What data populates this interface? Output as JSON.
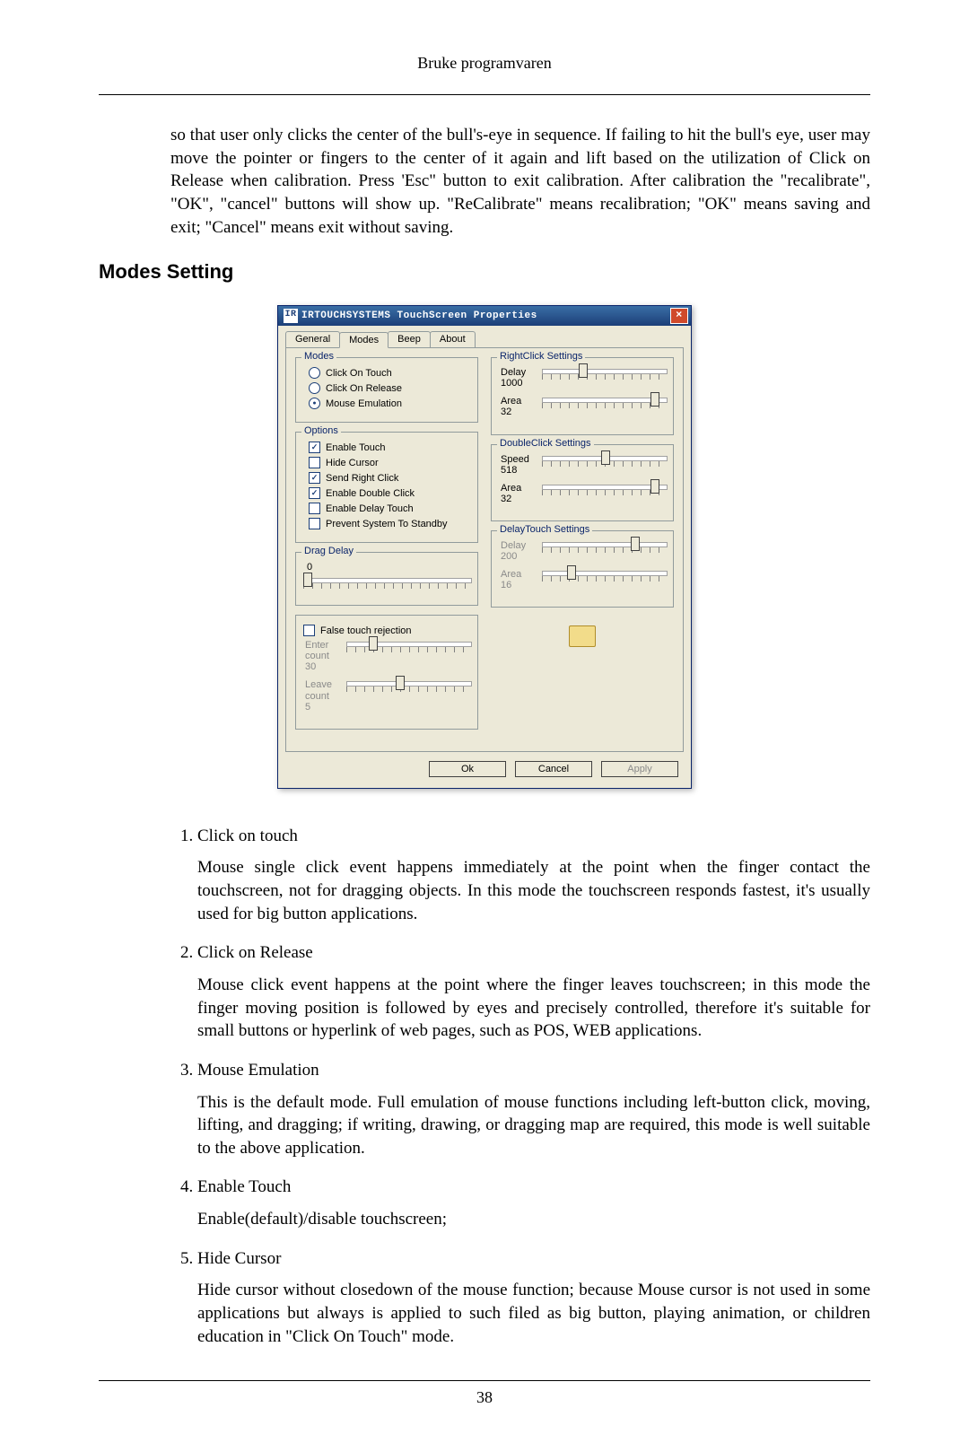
{
  "header": {
    "running_head": "Bruke programvaren"
  },
  "intro_paragraph": "so that user only clicks the center of the bull's-eye in sequence. If failing to hit the bull's eye, user may move the pointer or fingers to the center of it again and lift based on the utilization of Click on Release when calibration. Press 'Esc\" button to exit calibration. After calibration the \"recalibrate\", \"OK\", \"cancel\" buttons will show up. \"ReCalibrate\" means recalibration; \"OK\" means saving and exit; \"Cancel\" means exit without saving.",
  "section_title": "Modes Setting",
  "dialog": {
    "title": "IRTOUCHSYSTEMS TouchScreen Properties",
    "tabs": {
      "general": "General",
      "modes": "Modes",
      "beep": "Beep",
      "about": "About"
    },
    "modes_group": {
      "legend": "Modes",
      "click_on_touch": "Click On Touch",
      "click_on_release": "Click On Release",
      "mouse_emulation": "Mouse Emulation"
    },
    "options_group": {
      "legend": "Options",
      "enable_touch": "Enable Touch",
      "hide_cursor": "Hide Cursor",
      "send_right_click": "Send Right Click",
      "enable_double_click": "Enable Double Click",
      "enable_delay_touch": "Enable Delay Touch",
      "prevent_standby": "Prevent System To Standby"
    },
    "drag_delay": {
      "legend": "Drag Delay",
      "value": "0"
    },
    "false_touch": {
      "legend": "False touch rejection",
      "enter_label": "Enter count",
      "enter_value": "30",
      "leave_label": "Leave count",
      "leave_value": "5"
    },
    "rightclick": {
      "legend": "RightClick Settings",
      "delay_label": "Delay",
      "delay_value": "1000",
      "area_label": "Area",
      "area_value": "32"
    },
    "doubleclick": {
      "legend": "DoubleClick Settings",
      "speed_label": "Speed",
      "speed_value": "518",
      "area_label": "Area",
      "area_value": "32"
    },
    "delaytouch": {
      "legend": "DelayTouch Settings",
      "delay_label": "Delay",
      "delay_value": "200",
      "area_label": "Area",
      "area_value": "16"
    },
    "buttons": {
      "ok": "Ok",
      "cancel": "Cancel",
      "apply": "Apply"
    }
  },
  "definitions": [
    {
      "term": "Click on touch",
      "body": "Mouse single click event happens immediately at the point when the finger contact the touchscreen, not for dragging objects. In this mode the touchscreen responds fastest, it's usually used for big button applications."
    },
    {
      "term": "Click on Release",
      "body": "Mouse click event happens at the point where the finger leaves touchscreen; in this mode the finger moving position is followed by eyes and precisely controlled, therefore it's suitable for small buttons or hyperlink of web pages, such as POS, WEB applications."
    },
    {
      "term": "Mouse Emulation",
      "body": "This is the default mode. Full emulation of mouse functions including left-button click, moving, lifting, and dragging; if writing, drawing, or dragging map are required, this mode is well suitable to the above application."
    },
    {
      "term": "Enable Touch",
      "body": "Enable(default)/disable touchscreen;"
    },
    {
      "term": "Hide Cursor",
      "body": "Hide cursor without closedown of the mouse function; because Mouse cursor is not used in some applications but always is applied to such filed as big button, playing animation, or children education in \"Click On Touch\" mode."
    }
  ],
  "page_number": "38"
}
